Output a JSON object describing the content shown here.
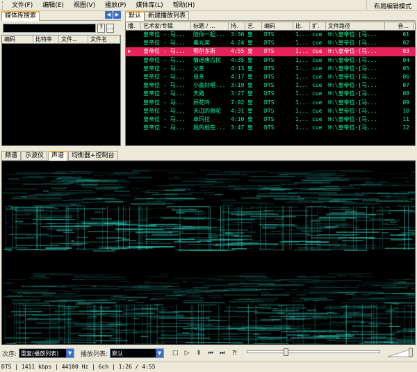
{
  "menu": {
    "items": [
      "文件(F)",
      "编辑(E)",
      "视图(V)",
      "播放(P)",
      "媒体库(L)",
      "帮助(H)"
    ],
    "right_label": "布局编辑模式"
  },
  "library": {
    "tab_label": "媒体库搜索",
    "search_value": "",
    "help_btn": "?",
    "more_btn": "...",
    "columns": [
      "编码",
      "比特率",
      "文件...",
      "文件名"
    ]
  },
  "playlist": {
    "tabs": [
      "默认",
      "新建播放列表"
    ],
    "columns": [
      "播.",
      "艺术家/专辑",
      "标题 / ...",
      "持.",
      "艺.",
      "编码",
      "比.",
      "扩.",
      "文件路径",
      "音..."
    ],
    "rows": [
      {
        "play": "",
        "artist": "皇帝位 - 马...",
        "title": "陪你一起...",
        "dur": "3:36",
        "art2": "皇",
        "codec": "DTS",
        "bit": "1...",
        "ext": "cue",
        "path": "H:\\皇帝位-[马...",
        "track": "01"
      },
      {
        "play": "",
        "artist": "皇帝位 - 马...",
        "title": "毒光美",
        "dur": "4:24",
        "art2": "皇",
        "codec": "DTS",
        "bit": "1...",
        "ext": "cue",
        "path": "H:\\皇帝位-[马...",
        "track": "02"
      },
      {
        "play": "▶",
        "artist": "皇帝位 - 马...",
        "title": "鄂尔多斯",
        "dur": "4:55",
        "art2": "皇",
        "codec": "DTS",
        "bit": "1...",
        "ext": "cue",
        "path": "H:\\皇帝位-[马...",
        "track": "03"
      },
      {
        "play": "",
        "artist": "皇帝位 - 马...",
        "title": "情迷唐古拉",
        "dur": "4:35",
        "art2": "皇",
        "codec": "DTS",
        "bit": "1...",
        "ext": "cue",
        "path": "H:\\皇帝位-[马...",
        "track": "04"
      },
      {
        "play": "",
        "artist": "皇帝位 - 马...",
        "title": "父亲",
        "dur": "4:13",
        "art2": "皇",
        "codec": "DTS",
        "bit": "1...",
        "ext": "cue",
        "path": "H:\\皇帝位-[马...",
        "track": "05"
      },
      {
        "play": "",
        "artist": "皇帝位 - 马...",
        "title": "母亲",
        "dur": "4:17",
        "art2": "皇",
        "codec": "DTS",
        "bit": "1...",
        "ext": "cue",
        "path": "H:\\皇帝位-[马...",
        "track": "06"
      },
      {
        "play": "",
        "artist": "皇帝位 - 马...",
        "title": "小曲好唱...",
        "dur": "3:19",
        "art2": "皇",
        "codec": "DTS",
        "bit": "1...",
        "ext": "cue",
        "path": "H:\\皇帝位-[马...",
        "track": "07"
      },
      {
        "play": "",
        "artist": "皇帝位 - 马...",
        "title": "天路",
        "dur": "3:27",
        "art2": "皇",
        "codec": "DTS",
        "bit": "1...",
        "ext": "cue",
        "path": "H:\\皇帝位-[马...",
        "track": "08"
      },
      {
        "play": "",
        "artist": "皇帝位 - 马...",
        "title": "葬花吟",
        "dur": "7:02",
        "art2": "皇",
        "codec": "DTS",
        "bit": "1...",
        "ext": "cue",
        "path": "H:\\皇帝位-[马...",
        "track": "09"
      },
      {
        "play": "",
        "artist": "皇帝位 - 马...",
        "title": "天边的骆驼",
        "dur": "4:31",
        "art2": "皇",
        "codec": "DTS",
        "bit": "1...",
        "ext": "cue",
        "path": "H:\\皇帝位-[马...",
        "track": "10"
      },
      {
        "play": "",
        "artist": "皇帝位 - 马...",
        "title": "卓玛拉",
        "dur": "4:10",
        "art2": "皇",
        "codec": "DTS",
        "bit": "1...",
        "ext": "cue",
        "path": "H:\\皇帝位-[马...",
        "track": "11"
      },
      {
        "play": "",
        "artist": "皇帝位 - 马...",
        "title": "我的根在...",
        "dur": "3:47",
        "art2": "皇",
        "codec": "DTS",
        "bit": "1...",
        "ext": "cue",
        "path": "H:\\皇帝位-[马...",
        "track": "12"
      }
    ]
  },
  "viz_tabs": [
    "频谱",
    "示波仪",
    "声谱",
    "均衡器+控制台"
  ],
  "controls": {
    "order_label": "次序:",
    "order_value": "重复(播放列表)",
    "playlist_label": "播放列表:",
    "playlist_value": "默认",
    "buttons": [
      "stop-icon",
      "play-icon",
      "pause-icon",
      "prev-icon",
      "next-icon",
      "random-icon"
    ],
    "seek_fraction": 0.28,
    "volume_fraction": 0.95
  },
  "status": {
    "text": "DTS | 1411 kbps | 44100 Hz | 6ch | 1:26 / 4:55"
  },
  "colors": {
    "playlist_text": "#00ff9e",
    "selected_row": "#e8225a",
    "spectrogram": "#2fd6c6",
    "tab_accent": "#f3b14a"
  }
}
